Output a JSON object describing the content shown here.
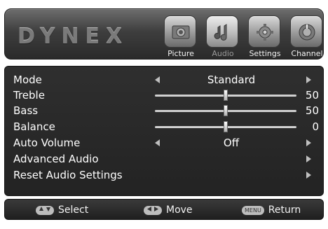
{
  "brand": {
    "logo_text": "DYNEX"
  },
  "tabs": [
    {
      "label": "Picture",
      "icon": "picture-icon",
      "active": false
    },
    {
      "label": "Audio",
      "icon": "audio-icon",
      "active": true
    },
    {
      "label": "Settings",
      "icon": "settings-icon",
      "active": false
    },
    {
      "label": "Channel",
      "icon": "channel-icon",
      "active": false
    }
  ],
  "menu": {
    "mode": {
      "label": "Mode",
      "value": "Standard"
    },
    "treble": {
      "label": "Treble",
      "value": "50",
      "level": 0.5
    },
    "bass": {
      "label": "Bass",
      "value": "50",
      "level": 0.5
    },
    "balance": {
      "label": "Balance",
      "value": "0",
      "level": 0.5
    },
    "auto_volume": {
      "label": "Auto Volume",
      "value": "Off"
    },
    "advanced_audio": {
      "label": "Advanced Audio"
    },
    "reset_audio": {
      "label": "Reset Audio Settings"
    }
  },
  "footer": {
    "select_label": "Select",
    "move_label": "Move",
    "menu_key": "MENU",
    "return_label": "Return"
  },
  "colors": {
    "panel_bg": "#2a2a2a",
    "header_top": "#6d6d6d",
    "text": "#ffffff",
    "arrow": "#bfbfbf"
  }
}
